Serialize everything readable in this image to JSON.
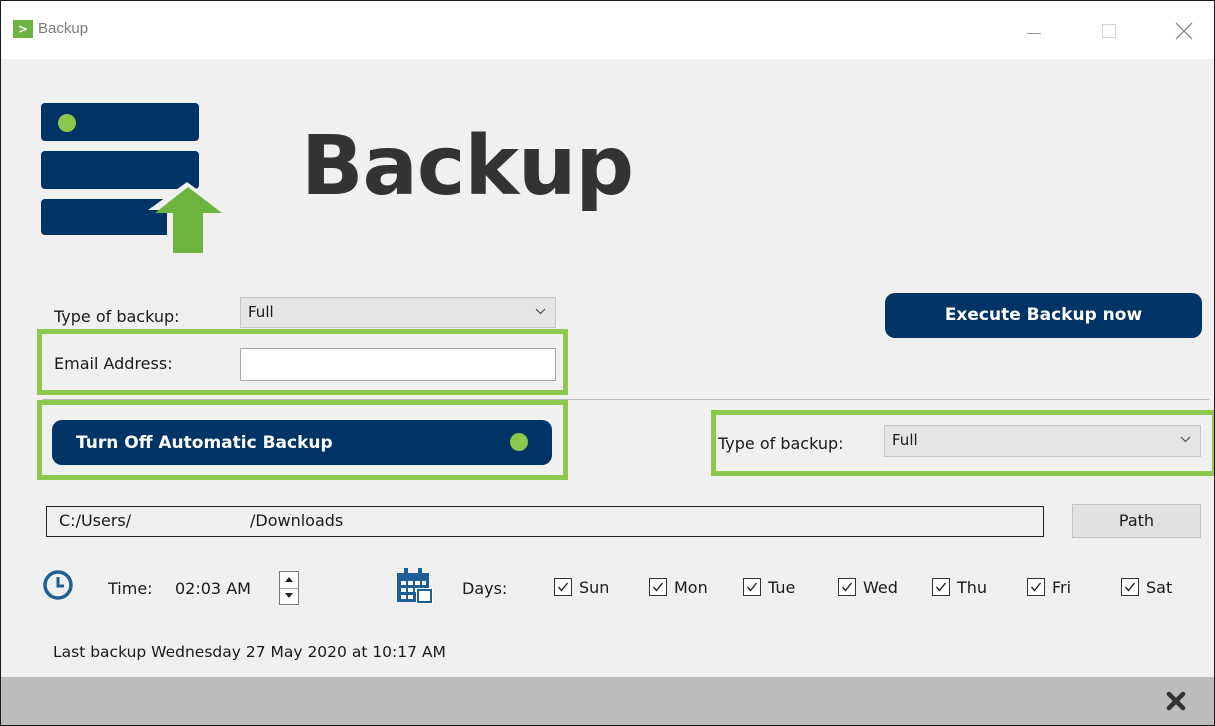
{
  "window": {
    "title": "Backup",
    "app_icon_glyph": "><"
  },
  "header": {
    "title": "Backup"
  },
  "form": {
    "type_label": "Type of backup:",
    "type_value": "Full",
    "email_label": "Email Address:",
    "email_value": ""
  },
  "actions": {
    "execute_label": "Execute Backup now",
    "auto_toggle_label": "Turn Off Automatic Backup"
  },
  "auto": {
    "type_label": "Type of backup:",
    "type_value": "Full"
  },
  "path": {
    "part1": "C:/Users/",
    "part2": "/Downloads",
    "button_label": "Path"
  },
  "schedule": {
    "time_label": "Time:",
    "time_value": "02:03 AM",
    "days_label": "Days:",
    "days": [
      {
        "label": "Sun",
        "checked": true
      },
      {
        "label": "Mon",
        "checked": true
      },
      {
        "label": "Tue",
        "checked": true
      },
      {
        "label": "Wed",
        "checked": true
      },
      {
        "label": "Thu",
        "checked": true
      },
      {
        "label": "Fri",
        "checked": true
      },
      {
        "label": "Sat",
        "checked": true
      }
    ]
  },
  "status": {
    "last_backup": "Last backup Wednesday 27 May 2020 at 10:17 AM"
  },
  "icons": {
    "logo": "server-upload-icon",
    "clock": "clock-icon",
    "calendar": "calendar-icon",
    "close": "close-icon"
  },
  "colors": {
    "navy": "#003366",
    "green": "#8cc84b",
    "text": "#1a1a1a",
    "logo_text": "#333333"
  }
}
